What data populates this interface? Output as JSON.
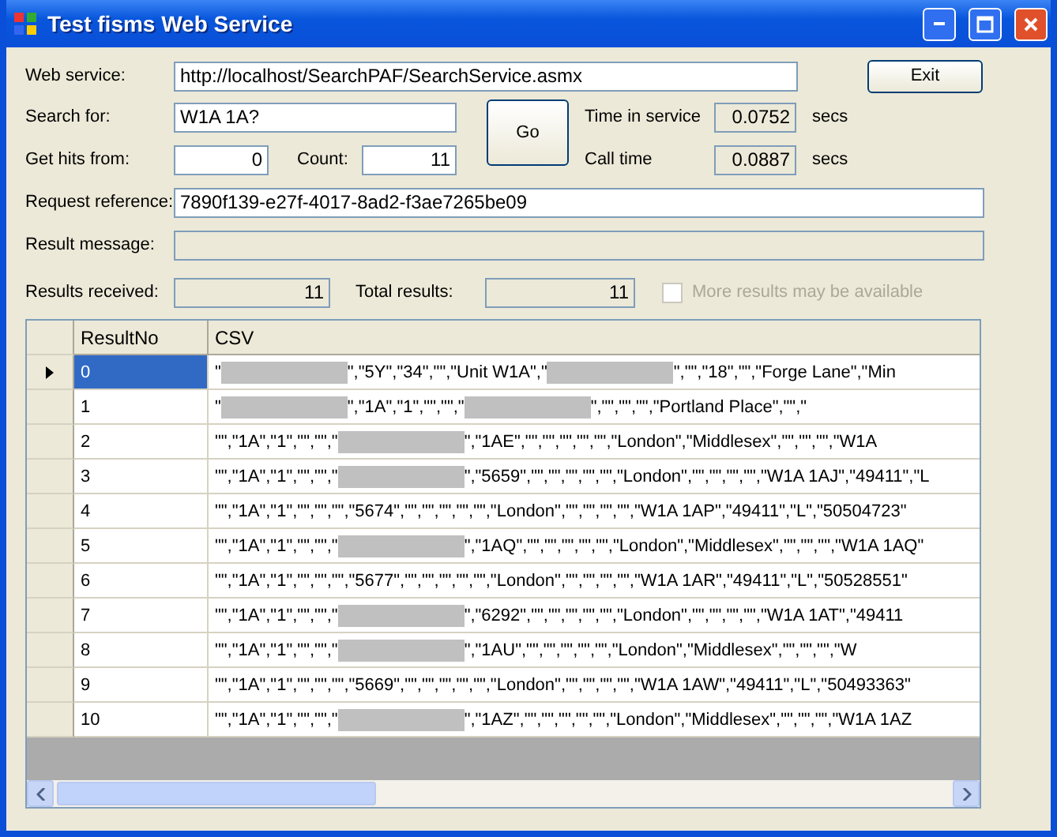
{
  "window": {
    "title": "Test fisms Web Service"
  },
  "form": {
    "web_service": {
      "label": "Web service:",
      "value": "http://localhost/SearchPAF/SearchService.asmx"
    },
    "exit_button": "Exit",
    "search_for": {
      "label": "Search for:",
      "value": "W1A 1A?"
    },
    "go_button": "Go",
    "time_in_service": {
      "label": "Time in service",
      "value": "0.0752",
      "unit": "secs"
    },
    "get_hits_from": {
      "label": "Get hits from:",
      "value": "0"
    },
    "count": {
      "label": "Count:",
      "value": "11"
    },
    "call_time": {
      "label": "Call time",
      "value": "0.0887",
      "unit": "secs"
    },
    "request_reference": {
      "label": "Request reference:",
      "value": "7890f139-e27f-4017-8ad2-f3ae7265be09"
    },
    "result_message": {
      "label": "Result message:"
    },
    "results_received": {
      "label": "Results received:",
      "value": "11"
    },
    "total_results": {
      "label": "Total results:",
      "value": "11"
    },
    "more_results": {
      "label": "More results may be available",
      "checked": false,
      "disabled": true
    }
  },
  "table": {
    "columns": [
      "ResultNo",
      "CSV"
    ],
    "rows": [
      {
        "no": "0",
        "selected": true,
        "csv": [
          {
            "kind": "text",
            "text": "\""
          },
          {
            "kind": "redacted"
          },
          {
            "kind": "text",
            "text": "\",\"5Y\",\"34\",\"\",\"Unit W1A\",\""
          },
          {
            "kind": "redacted"
          },
          {
            "kind": "text",
            "text": "\",\"\",\"18\",\"\",\"Forge Lane\",\"Min"
          }
        ]
      },
      {
        "no": "1",
        "selected": false,
        "csv": [
          {
            "kind": "text",
            "text": "\""
          },
          {
            "kind": "redacted"
          },
          {
            "kind": "text",
            "text": "\",\"1A\",\"1\",\"\",\"\",\""
          },
          {
            "kind": "redacted"
          },
          {
            "kind": "text",
            "text": "\",\"\",\"\",\"\",\"Portland Place\",\"\",\""
          }
        ]
      },
      {
        "no": "2",
        "selected": false,
        "csv": [
          {
            "kind": "text",
            "text": "\"\",\"1A\",\"1\",\"\",\"\",\""
          },
          {
            "kind": "redacted"
          },
          {
            "kind": "text",
            "text": "\",\"1AE\",\"\",\"\",\"\",\"\",\"\",\"London\",\"Middlesex\",\"\",\"\",\"\",\"W1A"
          }
        ]
      },
      {
        "no": "3",
        "selected": false,
        "csv": [
          {
            "kind": "text",
            "text": "\"\",\"1A\",\"1\",\"\",\"\",\""
          },
          {
            "kind": "redacted"
          },
          {
            "kind": "text",
            "text": "\",\"5659\",\"\",\"\",\"\",\"\",\"\",\"London\",\"\",\"\",\"\",\"\",\"W1A 1AJ\",\"49411\",\"L"
          }
        ]
      },
      {
        "no": "4",
        "selected": false,
        "csv": [
          {
            "kind": "text",
            "text": "\"\",\"1A\",\"1\",\"\",\"\",\"\",\"5674\",\"\",\"\",\"\",\"\",\"\",\"London\",\"\",\"\",\"\",\"\",\"W1A 1AP\",\"49411\",\"L\",\"50504723\""
          }
        ]
      },
      {
        "no": "5",
        "selected": false,
        "csv": [
          {
            "kind": "text",
            "text": "\"\",\"1A\",\"1\",\"\",\"\",\""
          },
          {
            "kind": "redacted"
          },
          {
            "kind": "text",
            "text": "\",\"1AQ\",\"\",\"\",\"\",\"\",\"\",\"London\",\"Middlesex\",\"\",\"\",\"\",\"W1A 1AQ\""
          }
        ]
      },
      {
        "no": "6",
        "selected": false,
        "csv": [
          {
            "kind": "text",
            "text": "\"\",\"1A\",\"1\",\"\",\"\",\"\",\"5677\",\"\",\"\",\"\",\"\",\"\",\"London\",\"\",\"\",\"\",\"\",\"W1A 1AR\",\"49411\",\"L\",\"50528551\""
          }
        ]
      },
      {
        "no": "7",
        "selected": false,
        "csv": [
          {
            "kind": "text",
            "text": "\"\",\"1A\",\"1\",\"\",\"\",\""
          },
          {
            "kind": "redacted"
          },
          {
            "kind": "text",
            "text": "\",\"6292\",\"\",\"\",\"\",\"\",\"\",\"London\",\"\",\"\",\"\",\"\",\"W1A 1AT\",\"49411"
          }
        ]
      },
      {
        "no": "8",
        "selected": false,
        "csv": [
          {
            "kind": "text",
            "text": "\"\",\"1A\",\"1\",\"\",\"\",\""
          },
          {
            "kind": "redacted"
          },
          {
            "kind": "text",
            "text": "\",\"1AU\",\"\",\"\",\"\",\"\",\"\",\"London\",\"Middlesex\",\"\",\"\",\"\",\"W"
          }
        ]
      },
      {
        "no": "9",
        "selected": false,
        "csv": [
          {
            "kind": "text",
            "text": "\"\",\"1A\",\"1\",\"\",\"\",\"\",\"5669\",\"\",\"\",\"\",\"\",\"\",\"London\",\"\",\"\",\"\",\"\",\"W1A 1AW\",\"49411\",\"L\",\"50493363\""
          }
        ]
      },
      {
        "no": "10",
        "selected": false,
        "csv": [
          {
            "kind": "text",
            "text": "\"\",\"1A\",\"1\",\"\",\"\",\""
          },
          {
            "kind": "redacted"
          },
          {
            "kind": "text",
            "text": "\",\"1AZ\",\"\",\"\",\"\",\"\",\"\",\"London\",\"Middlesex\",\"\",\"\",\"\",\"W1A 1AZ"
          }
        ]
      }
    ]
  }
}
